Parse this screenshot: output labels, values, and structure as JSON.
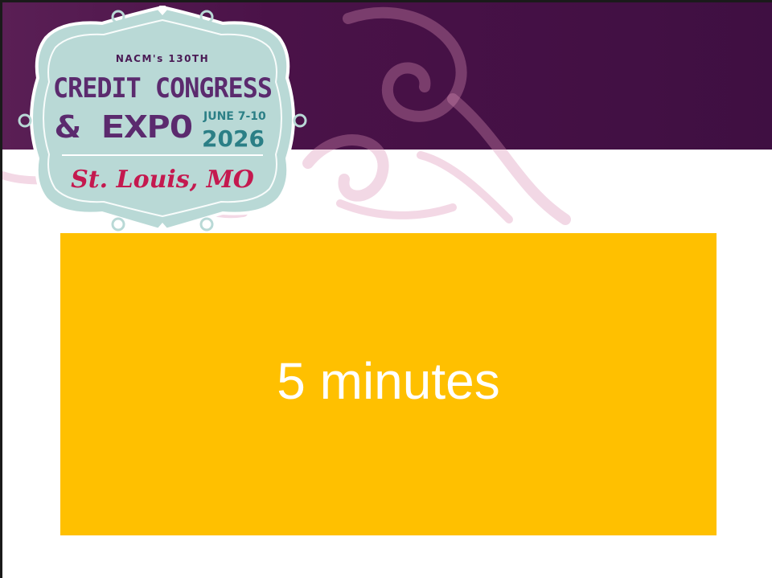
{
  "logo": {
    "edition": "NACM's 130TH",
    "line1": "CREDIT CONGRESS",
    "line2": "& EXPO",
    "dates": "JUNE 7-10",
    "year": "2026",
    "city": "St. Louis, MO"
  },
  "timer": {
    "label": "5 minutes"
  },
  "colors": {
    "header": "#4a1248",
    "accent_box": "#ffc000",
    "swirl": "#e9b8cf",
    "badge": "#b9d9d6"
  }
}
